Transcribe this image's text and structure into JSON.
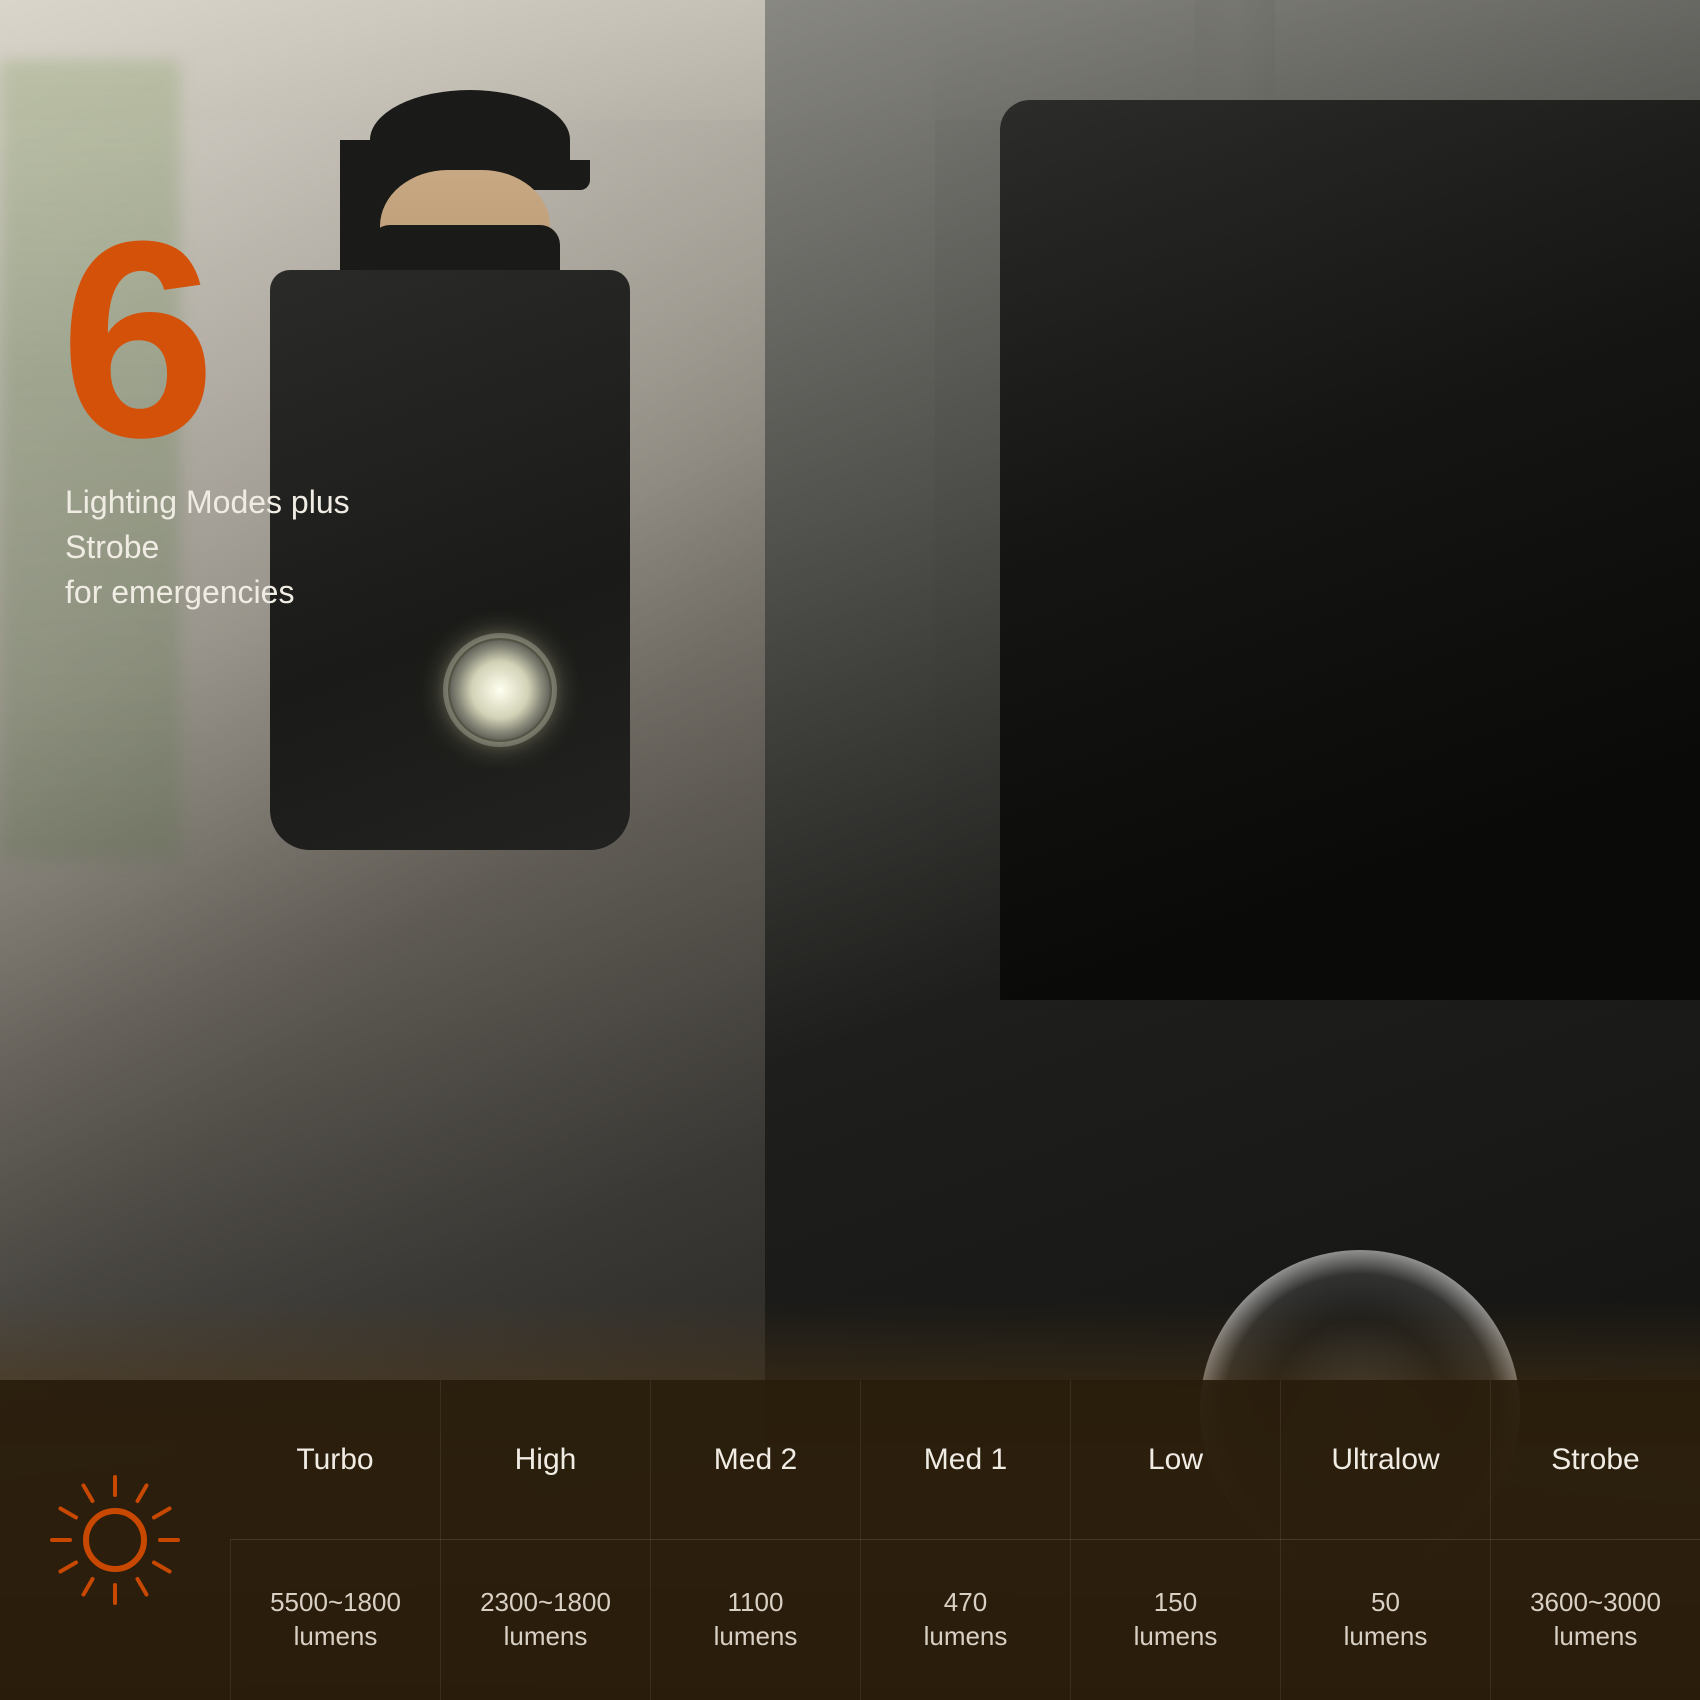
{
  "hero": {
    "number": "6",
    "line1": "Lighting Modes plus Strobe",
    "line2": "for emergencies"
  },
  "modes": [
    {
      "name": "Turbo",
      "value": "5500~1800\nlumens"
    },
    {
      "name": "High",
      "value": "2300~1800\nlumens"
    },
    {
      "name": "Med 2",
      "value": "1100\nlumens"
    },
    {
      "name": "Med 1",
      "value": "470\nlumens"
    },
    {
      "name": "Low",
      "value": "150\nlumens"
    },
    {
      "name": "Ultralow",
      "value": "50\nlumens"
    },
    {
      "name": "Strobe",
      "value": "3600~3000\nlumens"
    }
  ],
  "accent_color": "#D4510A",
  "bar_bg": "rgba(40,28,12,0.92)"
}
